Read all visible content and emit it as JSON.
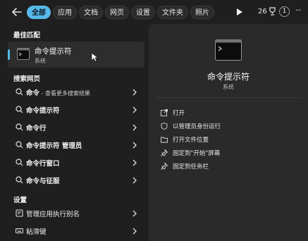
{
  "tabs": [
    "全部",
    "应用",
    "文档",
    "网页",
    "设置",
    "文件夹",
    "照片"
  ],
  "points": "26",
  "badge": "1",
  "more": "···",
  "sections": {
    "best_match": "最佳匹配",
    "search_web": "搜索网页",
    "settings": "设置"
  },
  "best_match": {
    "title": "命令提示符",
    "subtitle": "系统"
  },
  "web_results": [
    {
      "bold": "命令",
      "plain": "",
      "hint": " - 查看更多搜索结果"
    },
    {
      "bold": "命令提示符",
      "plain": "",
      "hint": ""
    },
    {
      "bold": "命令行",
      "plain": "",
      "hint": ""
    },
    {
      "bold": "命令提示符",
      "plain": " 管理员",
      "hint": ""
    },
    {
      "bold": "命令行窗口",
      "plain": "",
      "hint": ""
    },
    {
      "bold": "命令",
      "plain": "与征服",
      "hint": ""
    }
  ],
  "settings_results": [
    {
      "label": "管理应用执行别名"
    },
    {
      "label": "粘滞键"
    }
  ],
  "preview": {
    "title": "命令提示符",
    "subtitle": "系统"
  },
  "actions": [
    {
      "icon": "open-icon",
      "label": "打开"
    },
    {
      "icon": "shield-icon",
      "label": "以管理员身份运行"
    },
    {
      "icon": "folder-icon",
      "label": "打开文件位置"
    },
    {
      "icon": "pin-icon",
      "label": "固定到\"开始\"屏幕"
    },
    {
      "icon": "pin-icon",
      "label": "固定到任务栏"
    }
  ],
  "colors": {
    "accent": "#56b9ea",
    "background": "#1f1f1f",
    "panel": "#2a2a2a"
  }
}
